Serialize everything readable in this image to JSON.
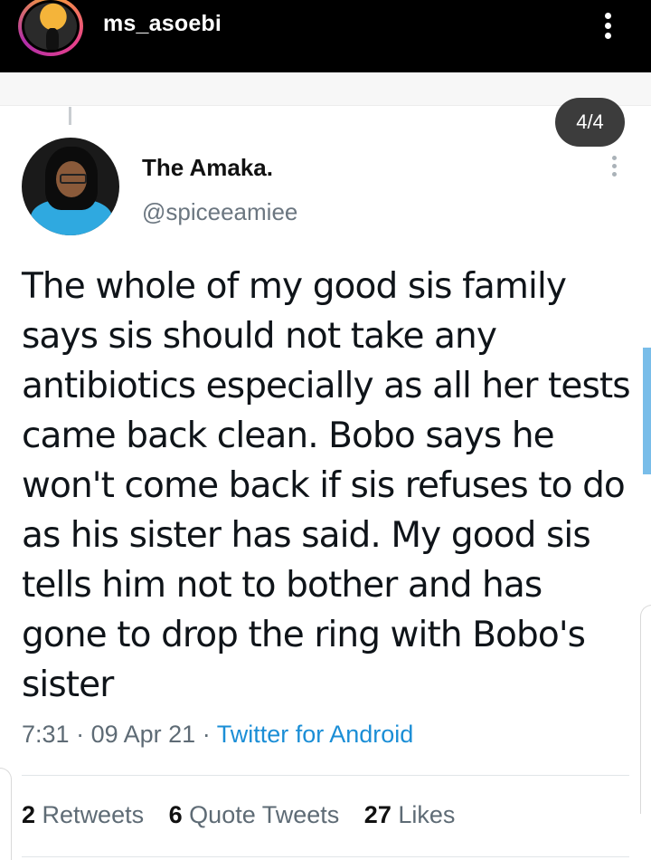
{
  "header": {
    "username": "ms_asoebi",
    "avatar_icon": "profile-logo",
    "menu_icon": "vertical-dots-icon"
  },
  "carousel": {
    "page_indicator": "4/4"
  },
  "tweet": {
    "display_name": "The Amaka.",
    "handle": "@spiceeamiee",
    "text": "The whole of my good sis family says sis should not take any antibiotics especially as all her tests came back clean. Bobo says he won't come back if sis refuses to do as his sister has said. My good sis tells him not to bother and has gone to drop the ring with Bobo's sister",
    "time": "7:31",
    "separator": "·",
    "date": "09 Apr 21",
    "source": "Twitter for Android",
    "stats": {
      "retweets_count": "2",
      "retweets_label": "Retweets",
      "quotes_count": "6",
      "quotes_label": "Quote Tweets",
      "likes_count": "27",
      "likes_label": "Likes"
    }
  },
  "colors": {
    "topbar": "#000000",
    "link": "#1b8ed6",
    "muted": "#5e6b75",
    "pill": "#3c3c3c"
  }
}
